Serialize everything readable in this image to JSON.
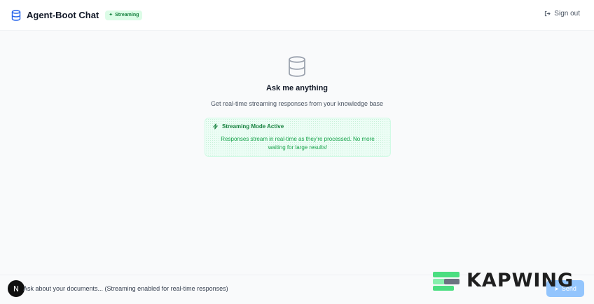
{
  "header": {
    "app_title": "Agent-Boot Chat",
    "badge_label": "Streaming",
    "signout_label": "Sign out"
  },
  "empty_state": {
    "heading": "Ask me anything",
    "subtitle": "Get real-time streaming responses from your knowledge base"
  },
  "stream_notice": {
    "title": "Streaming Mode Active",
    "body": "Responses stream in real-time as they're processed. No more waiting for large results!"
  },
  "composer": {
    "avatar_letter": "N",
    "placeholder": "Ask about your documents... (Streaming enabled for real-time responses)",
    "send_label": "Send"
  },
  "watermark": {
    "text": "KAPWING"
  },
  "colors": {
    "accent_blue": "#93c5fd",
    "green_text": "#15803d",
    "green_bg": "#ecfdf5",
    "badge_bg": "#dcfce7"
  }
}
